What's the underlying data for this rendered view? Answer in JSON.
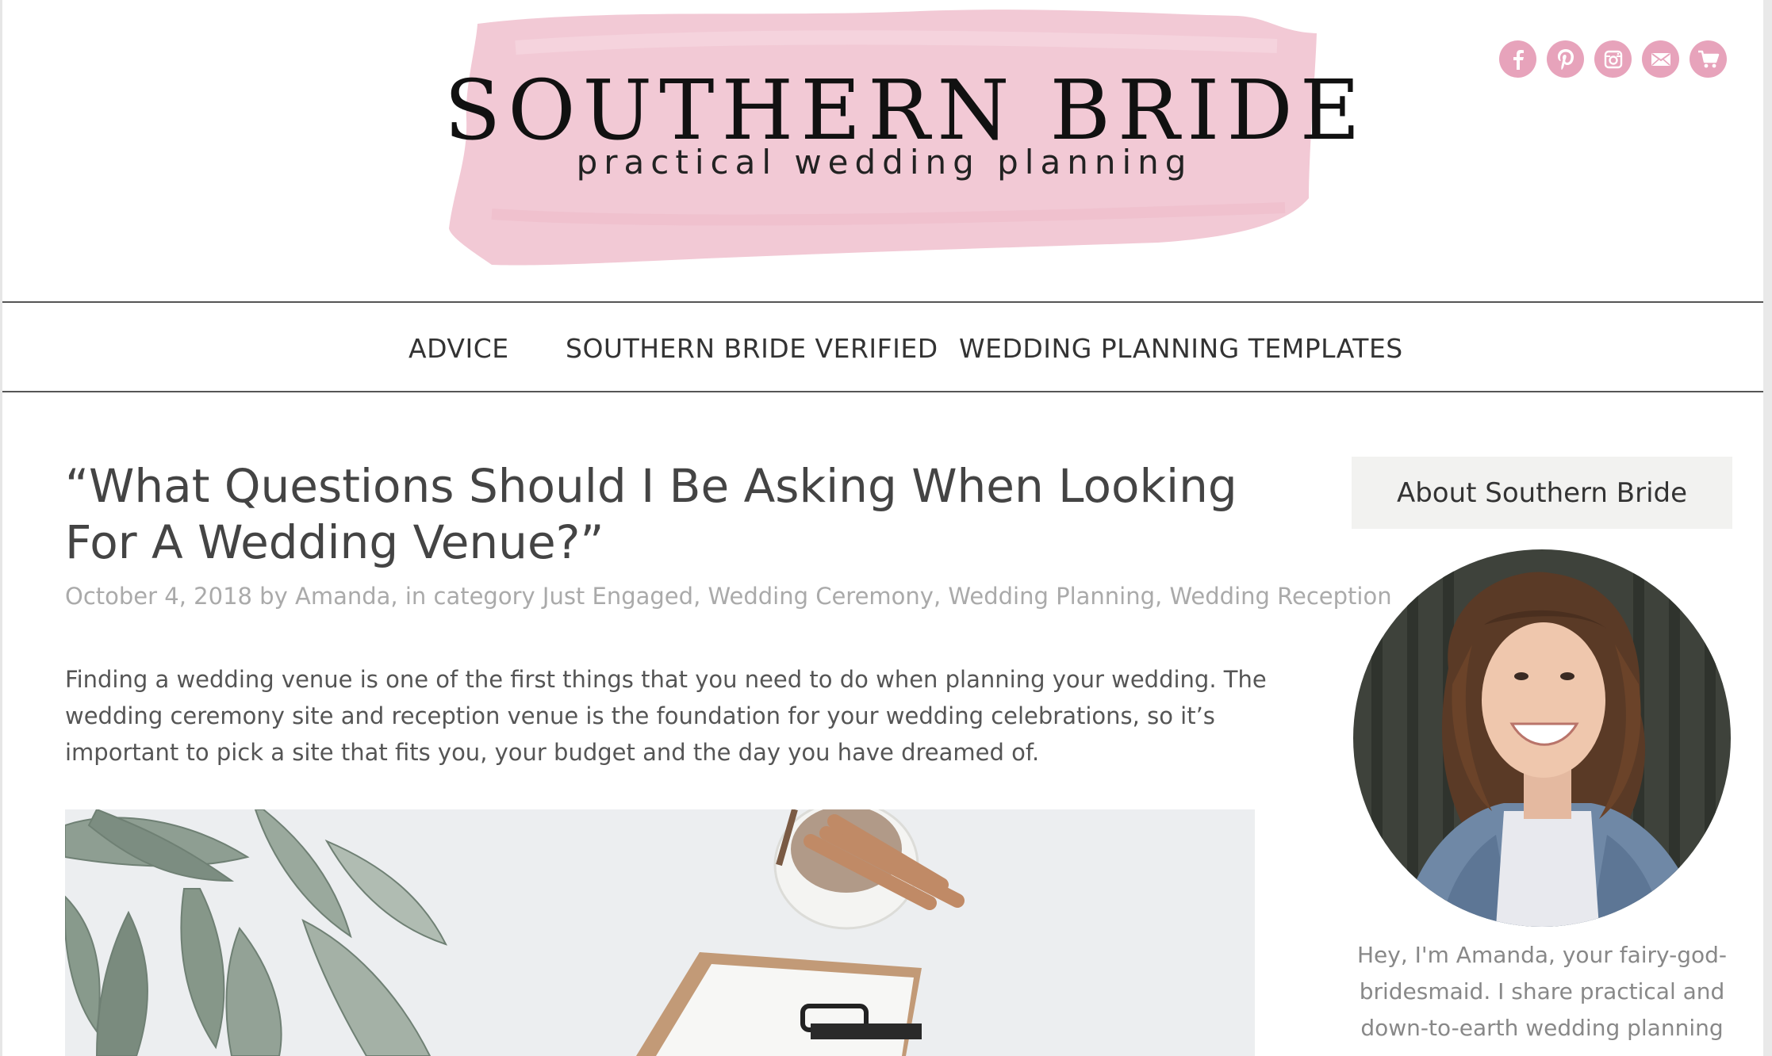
{
  "header": {
    "logo_title": "SOUTHERN BRIDE",
    "logo_subtitle": "practical wedding planning",
    "brush_color": "#f2c9d5"
  },
  "social": [
    {
      "name": "facebook-icon",
      "glyph": "f"
    },
    {
      "name": "pinterest-icon",
      "glyph": "p"
    },
    {
      "name": "instagram-icon",
      "glyph": "camera"
    },
    {
      "name": "email-icon",
      "glyph": "envelope"
    },
    {
      "name": "cart-icon",
      "glyph": "cart"
    }
  ],
  "social_color": "#e7a3bb",
  "nav": {
    "items": [
      {
        "label": "ADVICE"
      },
      {
        "label": "SOUTHERN BRIDE VERIFIED"
      },
      {
        "label": "WEDDING PLANNING TEMPLATES"
      }
    ]
  },
  "article": {
    "title": "“What Questions Should I Be Asking When Looking For A Wedding Venue?”",
    "meta": {
      "date": "October 4, 2018",
      "by": " by ",
      "author": "Amanda",
      "in_category": ", in category ",
      "categories": [
        "Just Engaged",
        "Wedding Ceremony",
        "Wedding Planning",
        "Wedding Reception"
      ],
      "separator": ", "
    },
    "intro": "Finding a wedding venue is one of the first things that you need to do when planning your wedding. The wedding ceremony site and reception venue is the foundation for your wedding celebrations, so it’s important to pick a site that fits you, your budget and the day you have dreamed of."
  },
  "sidebar": {
    "widget_title": "About Southern Bride",
    "bio": "Hey, I'm Amanda, your fairy-god-bridesmaid. I share practical and down-to-earth wedding planning"
  }
}
